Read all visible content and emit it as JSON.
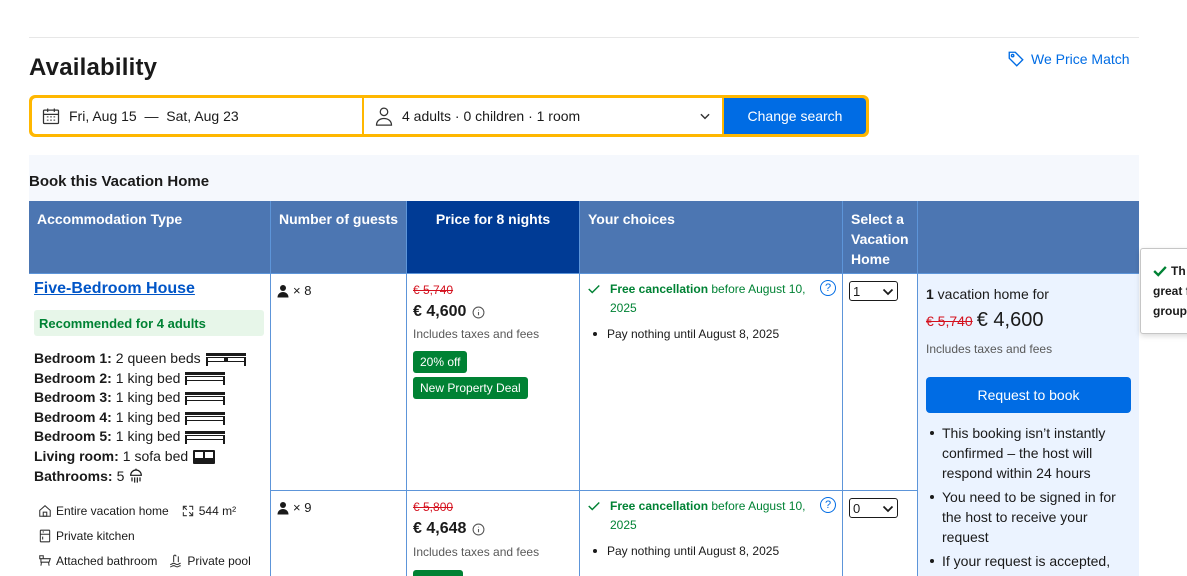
{
  "header": {
    "title": "Availability",
    "price_match": "We Price Match"
  },
  "search": {
    "dates": "Fri, Aug 15  —  Sat, Aug 23",
    "guests": "4 adults · 0 children · 1 room",
    "button": "Change search"
  },
  "book": {
    "title": "Book this Vacation Home",
    "columns": {
      "type": "Accommodation Type",
      "guests": "Number of guests",
      "price": "Price for 8 nights",
      "choices": "Your choices",
      "select": "Select a Vacation Home"
    },
    "accommodation": {
      "name": "Five-Bedroom House",
      "recommended": "Recommended for 4 adults",
      "rooms": [
        {
          "label": "Bedroom 1:",
          "value": "2 queen beds"
        },
        {
          "label": "Bedroom 2:",
          "value": "1 king bed"
        },
        {
          "label": "Bedroom 3:",
          "value": "1 king bed"
        },
        {
          "label": "Bedroom 4:",
          "value": "1 king bed"
        },
        {
          "label": "Bedroom 5:",
          "value": "1 king bed"
        },
        {
          "label": "Living room:",
          "value": "1 sofa bed"
        },
        {
          "label": "Bathrooms:",
          "value": "5"
        }
      ],
      "facilities": [
        "Entire vacation home",
        "544 m²",
        "Private kitchen",
        "Attached bathroom",
        "Private pool"
      ]
    },
    "options": [
      {
        "guests": "× 8",
        "old_price": "€ 5,740",
        "price": "€ 4,600",
        "taxes": "Includes taxes and fees",
        "badges": [
          "20% off",
          "New Property Deal"
        ],
        "cancel_bold": "Free cancellation",
        "cancel_rest": " before August 10, 2025",
        "pay": "Pay nothing until August 8, 2025",
        "select_value": "1"
      },
      {
        "guests": "× 9",
        "old_price": "€ 5,800",
        "price": "€ 4,648",
        "taxes": "Includes taxes and fees",
        "cancel_bold": "Free cancellation",
        "cancel_rest": " before August 10, 2025",
        "pay": "Pay nothing until August 8, 2025",
        "select_value": "0"
      }
    ],
    "summary": {
      "count": "1",
      "count_label": " vacation home for",
      "old_price": "€ 5,740",
      "price": "€ 4,600",
      "taxes": "Includes taxes and fees",
      "button": "Request to book",
      "notes": [
        "This booking isn’t instantly confirmed – the host will respond within 24 hours",
        "You need to be signed in for the host to receive your request",
        "If your request is accepted,"
      ]
    },
    "tooltip": [
      "Th",
      "great f",
      "group"
    ]
  },
  "colors": {
    "accent": "#006ce4",
    "header_bg": "#4c76b2",
    "selected_header": "#003b95",
    "search_border": "#ffb700",
    "green": "#008234",
    "red": "#d4111e"
  }
}
